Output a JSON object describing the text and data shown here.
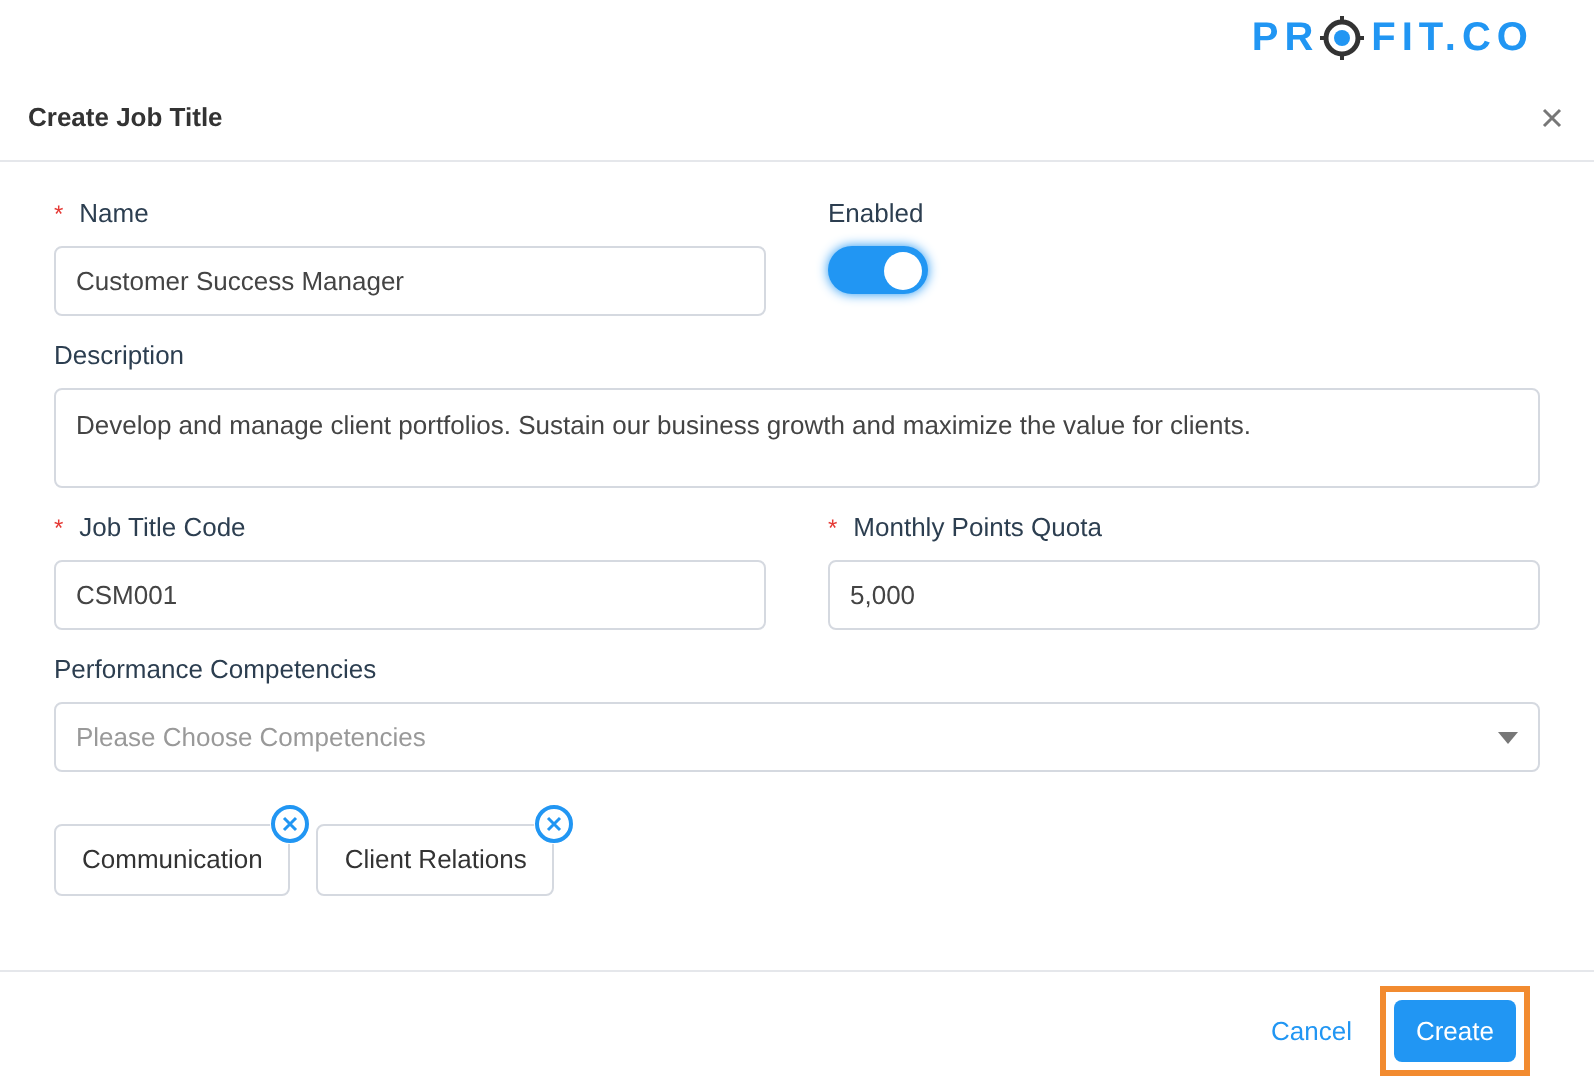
{
  "logo": {
    "before": "PR",
    "after": "FIT.CO"
  },
  "dialog": {
    "title": "Create Job Title"
  },
  "fields": [
    {
      "kind": "text",
      "label": "Name",
      "required_mark": "*",
      "value": "Customer Success Manager"
    },
    {
      "kind": "toggle",
      "label": "Enabled",
      "on": true
    },
    {
      "kind": "area",
      "label": "Description",
      "value": "Develop and manage client portfolios. Sustain our business growth and maximize the value for clients."
    },
    {
      "kind": "text",
      "label": "Job Title Code",
      "required_mark": "*",
      "value": "CSM001"
    },
    {
      "kind": "text",
      "label": "Monthly Points Quota",
      "required_mark": "*",
      "value": "5,000"
    },
    {
      "kind": "select",
      "label": "Performance Competencies",
      "placeholder": "Please Choose Competencies"
    }
  ],
  "tags": [
    "Communication",
    "Client Relations"
  ],
  "footer": {
    "cancel": "Cancel",
    "create": "Create",
    "create_highlighted": true
  }
}
